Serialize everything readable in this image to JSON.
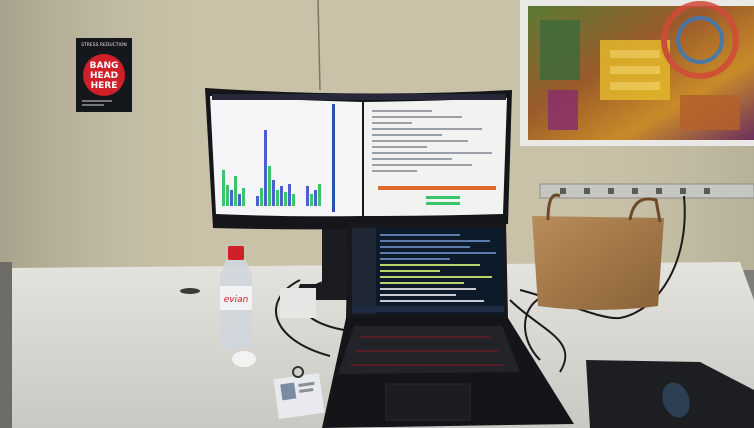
{
  "poster": {
    "header": "STRESS REDUCTION",
    "line1": "BANG",
    "line2": "HEAD",
    "line3": "HERE"
  },
  "bottle": {
    "brand": "evian"
  },
  "colors": {
    "wall": "#c9c2a8",
    "desk": "#d9d8d3",
    "monitor_bezel": "#15161a",
    "bag": "#a37a4c",
    "bottle_cap": "#d11f2a",
    "poster_bg": "#14171c",
    "chart_green": "#3cc46a",
    "chart_blue": "#4b5fd1"
  },
  "icons": {
    "poster_circle": "red-circle-icon",
    "bag": "paper-bag-icon",
    "mouse": "mouse-icon"
  }
}
